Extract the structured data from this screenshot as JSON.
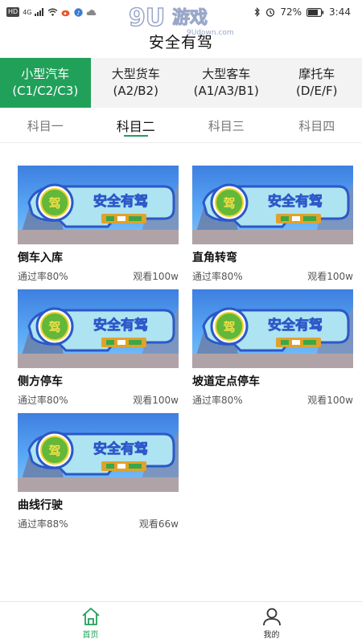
{
  "status_bar": {
    "hd": "HD",
    "network": "4G",
    "battery": "72%",
    "time": "3:44"
  },
  "watermark": {
    "brand": "9U游戏",
    "site": "9Udown.com"
  },
  "header": {
    "title": "安全有驾"
  },
  "categories": [
    {
      "name": "小型汽车",
      "code": "(C1/C2/C3)"
    },
    {
      "name": "大型货车",
      "code": "(A2/B2)"
    },
    {
      "name": "大型客车",
      "code": "(A1/A3/B1)"
    },
    {
      "name": "摩托车",
      "code": "(D/E/F)"
    }
  ],
  "subjects": [
    "科目一",
    "科目二",
    "科目三",
    "科目四"
  ],
  "thumb_text": "安全有驾",
  "videos": [
    {
      "title": "倒车入库",
      "pass_rate": "通过率80%",
      "views": "观看100w"
    },
    {
      "title": "直角转弯",
      "pass_rate": "通过率80%",
      "views": "观看100w"
    },
    {
      "title": "侧方停车",
      "pass_rate": "通过率80%",
      "views": "观看100w"
    },
    {
      "title": "坡道定点停车",
      "pass_rate": "通过率80%",
      "views": "观看100w"
    },
    {
      "title": "曲线行驶",
      "pass_rate": "通过率88%",
      "views": "观看66w"
    }
  ],
  "nav": [
    {
      "label": "首页",
      "icon": "home-icon"
    },
    {
      "label": "我的",
      "icon": "user-icon"
    }
  ],
  "colors": {
    "accent": "#21a05a"
  }
}
